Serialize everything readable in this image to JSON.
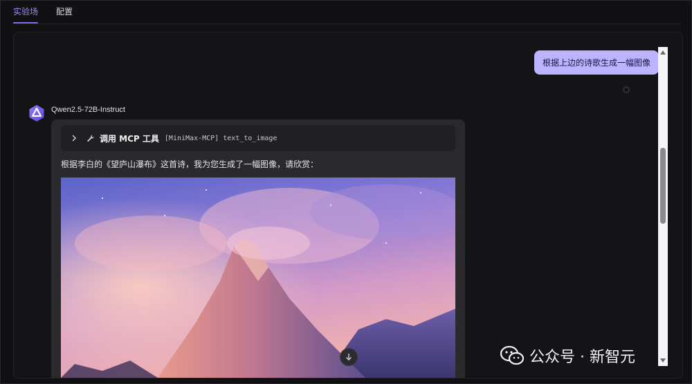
{
  "tabs": [
    {
      "label": "实验场",
      "active": true
    },
    {
      "label": "配置",
      "active": false
    }
  ],
  "chat": {
    "user_message": "根据上边的诗歌生成一幅图像",
    "bot": {
      "name": "Qwen2.5-72B-Instruct",
      "tool_call": {
        "title": "调用 MCP 工具",
        "server": "[MiniMax-MCP]",
        "tool": "text_to_image"
      },
      "answer": "根据李白的《望庐山瀑布》这首诗，我为您生成了一幅图像，请欣赏：",
      "image_icon": "generated-mountain-image"
    }
  },
  "watermark": {
    "text": "公众号 · 新智元",
    "icon": "wechat-icon"
  },
  "colors": {
    "accent": "#7c6ae8",
    "user_bubble": "#bdb4ff",
    "background": "#111113",
    "bot_bubble": "#2a2a2d"
  }
}
